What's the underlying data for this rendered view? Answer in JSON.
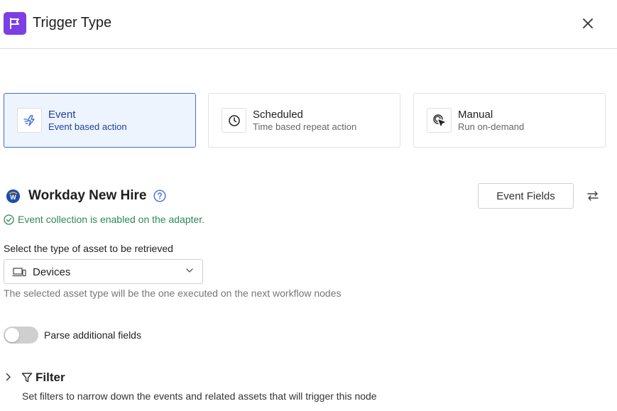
{
  "header": {
    "title": "Trigger Type",
    "icon": "flag-icon",
    "accent": "#7b3fe4"
  },
  "trigger_types": [
    {
      "title": "Event",
      "subtitle": "Event based action",
      "icon": "event-icon",
      "selected": true
    },
    {
      "title": "Scheduled",
      "subtitle": "Time based repeat action",
      "icon": "clock-icon",
      "selected": false
    },
    {
      "title": "Manual",
      "subtitle": "Run on-demand",
      "icon": "cursor-click-icon",
      "selected": false
    }
  ],
  "source": {
    "title": "Workday New Hire",
    "logo_letter": "W",
    "event_fields_label": "Event Fields",
    "status": "Event collection is enabled on the adapter."
  },
  "asset": {
    "label": "Select the type of asset to be retrieved",
    "value": "Devices",
    "help": "The selected asset type will be the one executed on the next workflow nodes"
  },
  "parse_toggle": {
    "label": "Parse additional fields",
    "enabled": false
  },
  "filter": {
    "title": "Filter",
    "description": "Set filters to narrow down the events and related assets that will trigger this node"
  },
  "colors": {
    "selected_border": "#3f6fd8",
    "selected_bg": "#eef4fd",
    "status_green": "#2e8a55"
  }
}
